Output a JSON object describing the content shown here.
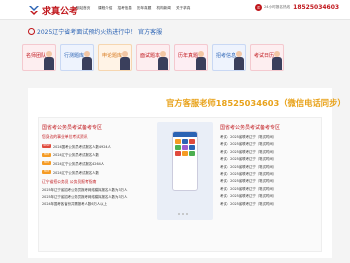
{
  "header": {
    "logo_text": "求真公考",
    "nav": [
      "网站首页",
      "课程介绍",
      "招考信息",
      "历年真题",
      "机构新闻",
      "关于求真"
    ],
    "phone_label": "24小时报名热线",
    "phone_number": "18525034603"
  },
  "notice": {
    "text": "2025辽宁省考面试预约火热进行中！  官方客服"
  },
  "quicknav": [
    {
      "label": "名师团队"
    },
    {
      "label": "行测题库"
    },
    {
      "label": "申论题库"
    },
    {
      "label": "面试题本"
    },
    {
      "label": "历年真题"
    },
    {
      "label": "招考信息"
    },
    {
      "label": "考试日历"
    }
  ],
  "main": {
    "hotline": "官方客服老师18525034603（微信电话同步）",
    "left": {
      "title": "国省考公务员考试备考专区",
      "sub1": "您身边的事业单位考试资讯",
      "items": [
        {
          "tag": "new",
          "text": "2024国考公务员考试报名人数4924人"
        },
        {
          "tag": "hot",
          "text": "2024辽宁公务员考试报名人数"
        },
        {
          "tag": "hot",
          "text": "2024辽宁公务员考试报名4264人"
        },
        {
          "tag": "hot",
          "text": "2024辽宁公务员考试报名人数"
        }
      ],
      "sub2": "辽宁省招公务员 公务员报考指南",
      "plain": [
        "2025年辽宁省招考公务员报考网络模拟报名人数为3万人",
        "2025年辽宁省招考公务员报考网络模拟报名人数为3万人",
        "2024年国考各省份共需报考人数6万人以上"
      ]
    },
    "right": {
      "title": "国省考公务员考试备考专区",
      "rows": [
        "考试：2025省联考辽宁（笔试时间）",
        "考试：2025省联考辽宁（笔试时间）",
        "考试：2025省联考辽宁（笔试时间）",
        "考试：2025省联考辽宁（笔试时间）",
        "考试：2025省联考辽宁（笔试时间）",
        "考试：2025省联考辽宁（笔试时间）",
        "考试：2025省联考辽宁（笔试时间）",
        "考试：2025省联考辽宁（笔试时间）",
        "考试：2025省联考辽宁（笔试时间）",
        "考试：2025省联考辽宁（笔试时间）"
      ]
    }
  },
  "colors": {
    "brand": "#c0161b",
    "link": "#2b63b4",
    "accent": "#e8a21a"
  }
}
